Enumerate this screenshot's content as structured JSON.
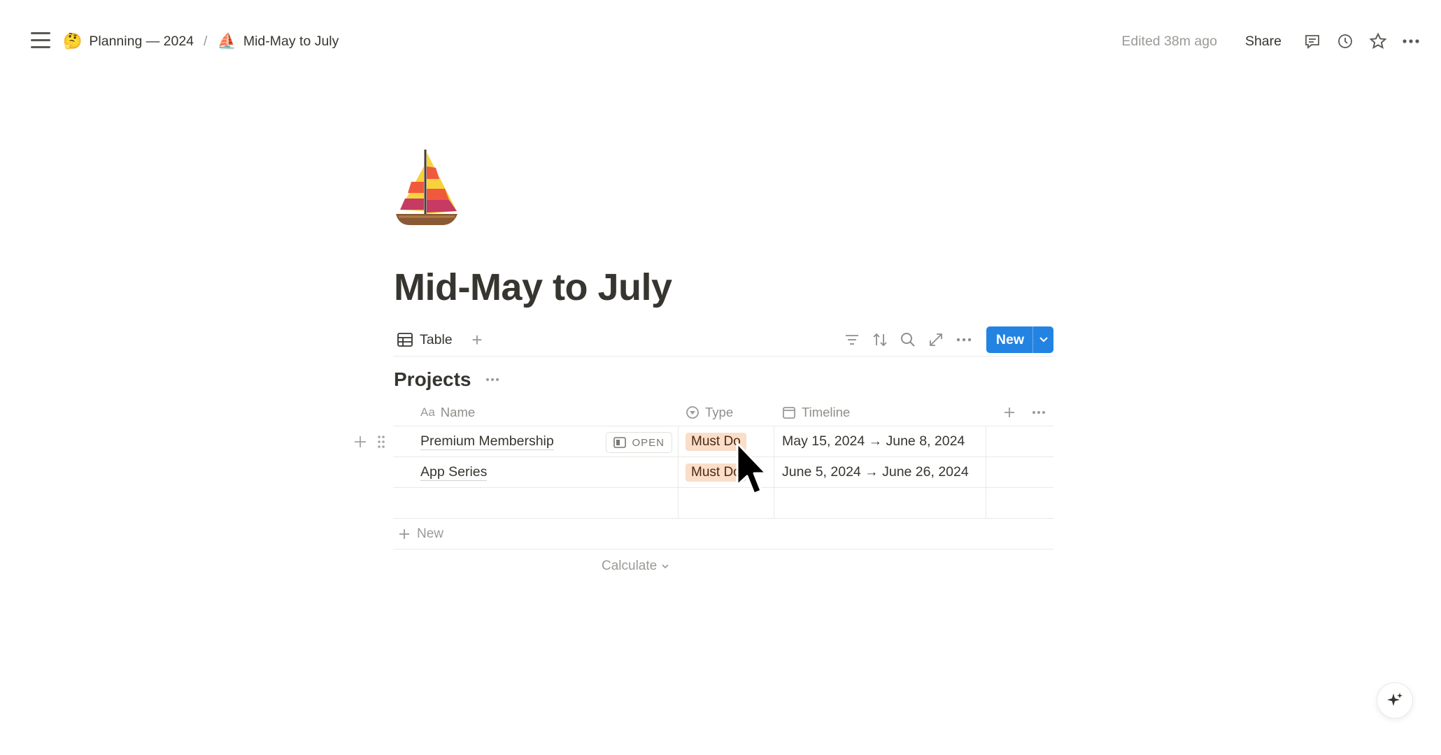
{
  "topbar": {
    "breadcrumb": [
      {
        "emoji": "🤔",
        "label": "Planning — 2024"
      },
      {
        "emoji": "⛵",
        "label": "Mid-May to July"
      }
    ],
    "separator": "/",
    "edited": "Edited 38m ago",
    "share_label": "Share",
    "icons": [
      "comment-icon",
      "history-icon",
      "star-icon",
      "more-icon"
    ]
  },
  "page": {
    "icon": "sailboat",
    "title": "Mid-May to July"
  },
  "view": {
    "tab_label": "Table",
    "new_label": "New",
    "tools": [
      "filter-icon",
      "sort-icon",
      "search-icon",
      "expand-icon",
      "more-icon"
    ]
  },
  "database": {
    "title": "Projects",
    "columns": {
      "name_prefix": "Aa",
      "name": "Name",
      "type": "Type",
      "timeline": "Timeline"
    },
    "rows": [
      {
        "name": "Premium Membership",
        "type": "Must Do",
        "timeline": "May 15, 2024 → June 8, 2024",
        "open_label": "OPEN"
      },
      {
        "name": "App Series",
        "type": "Must Do",
        "timeline": "June 5, 2024 → June 26, 2024"
      }
    ],
    "new_row_label": "New",
    "calculate_label": "Calculate"
  },
  "colors": {
    "accent": "#2383e2",
    "tag_bg": "#fadec9",
    "tag_text": "#49290e",
    "text": "#37352f",
    "muted": "#9b9a97"
  }
}
